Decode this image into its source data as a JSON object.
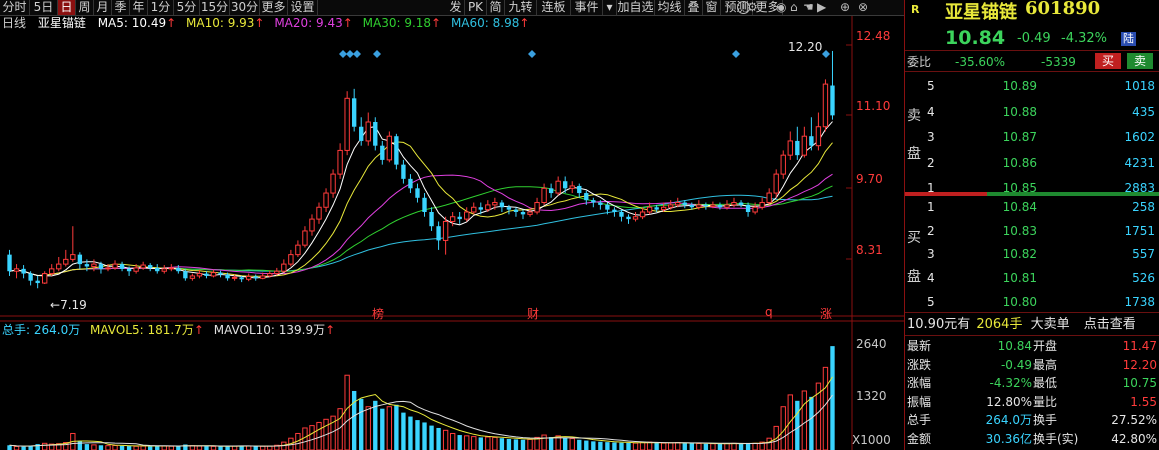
{
  "toolbar": {
    "left": [
      "分时",
      "5日",
      "日",
      "周",
      "月",
      "季",
      "年",
      "1分",
      "5分",
      "15分",
      "30分",
      "更多",
      "设置"
    ],
    "active_index": 2,
    "right": [
      "发",
      "PK",
      "简",
      "九转",
      "连板",
      "事件",
      "",
      "加自选",
      "均线",
      "叠",
      "窗",
      "预测",
      "更多"
    ]
  },
  "ma_legend": {
    "period": "日线",
    "name": "亚星锚链",
    "ma5": "MA5: 10.49",
    "ma10": "MA10: 9.93",
    "ma20": "MA20: 9.43",
    "ma30": "MA30: 9.18",
    "ma60": "MA60: 8.98"
  },
  "colors": {
    "ma5": "#ffffff",
    "ma10": "#e8e83a",
    "ma20": "#e040e0",
    "ma30": "#30d030",
    "ma60": "#30c0e0",
    "up": "#ff3b3b",
    "down": "#3ad4ff"
  },
  "price_axis": [
    "12.48",
    "11.10",
    "9.70",
    "8.31"
  ],
  "high_label": "12.20",
  "low_label": "7.19",
  "event_markers": [
    "榜",
    "财",
    "q",
    "涨"
  ],
  "volume_legend": {
    "total": "总手: 264.0万",
    "mavol5": "MAVOL5: 181.7万",
    "mavol10": "MAVOL10: 139.9万"
  },
  "volume_axis": [
    "2640",
    "1320",
    "X1000"
  ],
  "quote": {
    "badge": "R",
    "name": "亚星锚链",
    "code": "601890",
    "price": "10.84",
    "change": "-0.49",
    "change_pct": "-4.32%",
    "tag": "陆"
  },
  "weibi": {
    "label": "委比",
    "pct": "-35.60%",
    "diff": "-5339",
    "buy": "买",
    "sell": "卖"
  },
  "sell_side_label": [
    "卖",
    "盘"
  ],
  "buy_side_label": [
    "买",
    "盘"
  ],
  "sell_orders": [
    {
      "level": "5",
      "price": "10.89",
      "vol": "1018"
    },
    {
      "level": "4",
      "price": "10.88",
      "vol": "435"
    },
    {
      "level": "3",
      "price": "10.87",
      "vol": "1602"
    },
    {
      "level": "2",
      "price": "10.86",
      "vol": "4231"
    },
    {
      "level": "1",
      "price": "10.85",
      "vol": "2883"
    }
  ],
  "buy_orders": [
    {
      "level": "1",
      "price": "10.84",
      "vol": "258"
    },
    {
      "level": "2",
      "price": "10.83",
      "vol": "1751"
    },
    {
      "level": "3",
      "price": "10.82",
      "vol": "557"
    },
    {
      "level": "4",
      "price": "10.81",
      "vol": "526"
    },
    {
      "level": "5",
      "price": "10.80",
      "vol": "1738"
    }
  ],
  "big_order": {
    "price": "10.90元有",
    "vol": "2064手",
    "label": "大卖单",
    "link": "点击查看"
  },
  "stats": [
    {
      "l1": "最新",
      "v1": "10.84",
      "c1": "green",
      "l2": "开盘",
      "v2": "11.47",
      "c2": "red"
    },
    {
      "l1": "涨跌",
      "v1": "-0.49",
      "c1": "green",
      "l2": "最高",
      "v2": "12.20",
      "c2": "red"
    },
    {
      "l1": "涨幅",
      "v1": "-4.32%",
      "c1": "green",
      "l2": "最低",
      "v2": "10.75",
      "c2": "green"
    },
    {
      "l1": "振幅",
      "v1": "12.80%",
      "c1": "white",
      "l2": "量比",
      "v2": "1.55",
      "c2": "red"
    },
    {
      "l1": "总手",
      "v1": "264.0万",
      "c1": "cyan",
      "l2": "换手",
      "v2": "27.52%",
      "c2": "white"
    },
    {
      "l1": "金额",
      "v1": "30.36亿",
      "c1": "cyan",
      "l2": "换手(实)",
      "v2": "42.80%",
      "c2": "white"
    }
  ],
  "chart_data": {
    "type": "candlestick",
    "price_range": [
      6.9,
      12.6
    ],
    "volume_max": 2640,
    "candles": [
      [
        7.9,
        7.55,
        8.0,
        7.45,
        120
      ],
      [
        7.55,
        7.6,
        7.7,
        7.4,
        90
      ],
      [
        7.6,
        7.5,
        7.68,
        7.4,
        85
      ],
      [
        7.5,
        7.35,
        7.55,
        7.25,
        110
      ],
      [
        7.35,
        7.3,
        7.45,
        7.19,
        150
      ],
      [
        7.3,
        7.5,
        7.55,
        7.28,
        170
      ],
      [
        7.5,
        7.6,
        7.7,
        7.45,
        150
      ],
      [
        7.6,
        7.7,
        7.85,
        7.55,
        160
      ],
      [
        7.7,
        7.8,
        8.0,
        7.65,
        190
      ],
      [
        7.8,
        7.9,
        8.5,
        7.75,
        420
      ],
      [
        7.9,
        7.7,
        7.95,
        7.6,
        220
      ],
      [
        7.7,
        7.65,
        7.8,
        7.55,
        150
      ],
      [
        7.65,
        7.7,
        7.8,
        7.55,
        130
      ],
      [
        7.7,
        7.6,
        7.75,
        7.5,
        120
      ],
      [
        7.6,
        7.62,
        7.7,
        7.55,
        110
      ],
      [
        7.62,
        7.7,
        7.78,
        7.58,
        115
      ],
      [
        7.7,
        7.6,
        7.75,
        7.55,
        105
      ],
      [
        7.6,
        7.55,
        7.65,
        7.45,
        100
      ],
      [
        7.55,
        7.62,
        7.7,
        7.5,
        95
      ],
      [
        7.62,
        7.68,
        7.75,
        7.58,
        100
      ],
      [
        7.68,
        7.62,
        7.72,
        7.55,
        110
      ],
      [
        7.62,
        7.55,
        7.7,
        7.5,
        105
      ],
      [
        7.55,
        7.6,
        7.68,
        7.5,
        100
      ],
      [
        7.6,
        7.62,
        7.7,
        7.55,
        95
      ],
      [
        7.62,
        7.55,
        7.68,
        7.5,
        90
      ],
      [
        7.55,
        7.4,
        7.6,
        7.35,
        140
      ],
      [
        7.4,
        7.45,
        7.5,
        7.35,
        110
      ],
      [
        7.45,
        7.5,
        7.58,
        7.4,
        100
      ],
      [
        7.5,
        7.45,
        7.55,
        7.4,
        95
      ],
      [
        7.45,
        7.52,
        7.58,
        7.42,
        92
      ],
      [
        7.52,
        7.48,
        7.56,
        7.42,
        90
      ],
      [
        7.48,
        7.4,
        7.52,
        7.35,
        110
      ],
      [
        7.4,
        7.42,
        7.48,
        7.35,
        100
      ],
      [
        7.42,
        7.38,
        7.45,
        7.32,
        105
      ],
      [
        7.38,
        7.44,
        7.5,
        7.34,
        100
      ],
      [
        7.44,
        7.4,
        7.48,
        7.35,
        95
      ],
      [
        7.4,
        7.45,
        7.52,
        7.38,
        95
      ],
      [
        7.45,
        7.5,
        7.56,
        7.42,
        100
      ],
      [
        7.5,
        7.55,
        7.62,
        7.46,
        120
      ],
      [
        7.55,
        7.7,
        7.8,
        7.52,
        200
      ],
      [
        7.7,
        7.9,
        8.0,
        7.65,
        300
      ],
      [
        7.9,
        8.1,
        8.2,
        7.85,
        420
      ],
      [
        8.1,
        8.4,
        8.5,
        8.05,
        560
      ],
      [
        8.4,
        8.65,
        8.75,
        8.3,
        620
      ],
      [
        8.65,
        8.9,
        9.0,
        8.55,
        700
      ],
      [
        8.9,
        9.2,
        9.3,
        8.8,
        780
      ],
      [
        9.2,
        9.6,
        9.7,
        9.1,
        860
      ],
      [
        9.6,
        10.1,
        10.25,
        9.5,
        1050
      ],
      [
        10.1,
        11.2,
        11.35,
        10.0,
        1900
      ],
      [
        11.2,
        10.6,
        11.4,
        10.5,
        1500
      ],
      [
        10.6,
        10.3,
        10.8,
        10.2,
        1300
      ],
      [
        10.3,
        10.7,
        10.9,
        10.2,
        1100
      ],
      [
        10.7,
        10.2,
        10.8,
        10.1,
        1250
      ],
      [
        10.2,
        9.9,
        10.3,
        9.8,
        1050
      ],
      [
        9.9,
        10.4,
        10.5,
        9.85,
        1100
      ],
      [
        10.4,
        9.8,
        10.45,
        9.7,
        1150
      ],
      [
        9.8,
        9.5,
        9.9,
        9.4,
        950
      ],
      [
        9.5,
        9.3,
        9.6,
        9.2,
        850
      ],
      [
        9.3,
        9.1,
        9.4,
        9.0,
        760
      ],
      [
        9.1,
        8.8,
        9.2,
        8.7,
        700
      ],
      [
        8.8,
        8.5,
        8.9,
        8.4,
        620
      ],
      [
        8.5,
        8.2,
        8.6,
        8.0,
        560
      ],
      [
        8.2,
        8.6,
        8.7,
        7.9,
        500
      ],
      [
        8.6,
        8.7,
        8.8,
        8.5,
        420
      ],
      [
        8.7,
        8.65,
        8.8,
        8.55,
        380
      ],
      [
        8.65,
        8.8,
        8.9,
        8.6,
        360
      ],
      [
        8.8,
        8.9,
        9.0,
        8.75,
        340
      ],
      [
        8.9,
        8.85,
        9.0,
        8.75,
        320
      ],
      [
        8.85,
        8.95,
        9.05,
        8.8,
        330
      ],
      [
        8.95,
        9.0,
        9.1,
        8.85,
        320
      ],
      [
        9.0,
        8.9,
        9.05,
        8.8,
        300
      ],
      [
        8.9,
        8.85,
        8.95,
        8.75,
        280
      ],
      [
        8.85,
        8.8,
        8.9,
        8.7,
        270
      ],
      [
        8.8,
        8.75,
        8.85,
        8.65,
        260
      ],
      [
        8.75,
        8.8,
        8.88,
        8.7,
        270
      ],
      [
        8.8,
        9.0,
        9.1,
        8.75,
        320
      ],
      [
        9.0,
        9.3,
        9.4,
        8.95,
        380
      ],
      [
        9.3,
        9.2,
        9.4,
        9.1,
        330
      ],
      [
        9.2,
        9.45,
        9.55,
        9.15,
        360
      ],
      [
        9.45,
        9.3,
        9.55,
        9.2,
        310
      ],
      [
        9.3,
        9.35,
        9.45,
        9.2,
        290
      ],
      [
        9.35,
        9.2,
        9.4,
        9.1,
        260
      ],
      [
        9.2,
        9.05,
        9.25,
        8.95,
        240
      ],
      [
        9.05,
        9.0,
        9.1,
        8.9,
        220
      ],
      [
        9.0,
        8.95,
        9.05,
        8.85,
        210
      ],
      [
        8.95,
        8.85,
        9.0,
        8.75,
        200
      ],
      [
        8.85,
        8.8,
        8.9,
        8.7,
        190
      ],
      [
        8.8,
        8.7,
        8.85,
        8.6,
        185
      ],
      [
        8.7,
        8.65,
        8.75,
        8.55,
        180
      ],
      [
        8.65,
        8.7,
        8.8,
        8.6,
        175
      ],
      [
        8.7,
        8.8,
        8.9,
        8.65,
        190
      ],
      [
        8.8,
        8.9,
        9.0,
        8.75,
        200
      ],
      [
        8.9,
        8.85,
        8.95,
        8.8,
        180
      ],
      [
        8.85,
        8.9,
        9.0,
        8.8,
        175
      ],
      [
        8.9,
        8.95,
        9.05,
        8.85,
        180
      ],
      [
        8.95,
        9.0,
        9.1,
        8.9,
        190
      ],
      [
        9.0,
        8.95,
        9.05,
        8.88,
        175
      ],
      [
        8.95,
        8.9,
        9.0,
        8.85,
        170
      ],
      [
        8.9,
        8.95,
        9.05,
        8.85,
        165
      ],
      [
        8.95,
        8.92,
        9.0,
        8.85,
        160
      ],
      [
        8.92,
        8.95,
        9.02,
        8.88,
        160
      ],
      [
        8.95,
        8.9,
        9.0,
        8.85,
        155
      ],
      [
        8.9,
        8.95,
        9.05,
        8.85,
        165
      ],
      [
        8.95,
        9.0,
        9.1,
        8.9,
        170
      ],
      [
        9.0,
        8.95,
        9.05,
        8.9,
        160
      ],
      [
        8.95,
        8.8,
        9.0,
        8.7,
        180
      ],
      [
        8.8,
        8.9,
        9.0,
        8.75,
        170
      ],
      [
        8.9,
        9.0,
        9.1,
        8.85,
        200
      ],
      [
        9.0,
        9.2,
        9.3,
        8.95,
        300
      ],
      [
        9.2,
        9.6,
        9.7,
        9.1,
        600
      ],
      [
        9.6,
        10.0,
        10.1,
        9.5,
        1100
      ],
      [
        10.0,
        10.3,
        10.5,
        9.9,
        1400
      ],
      [
        10.3,
        10.0,
        10.6,
        9.9,
        1250
      ],
      [
        10.0,
        10.4,
        10.6,
        9.95,
        1500
      ],
      [
        10.4,
        10.2,
        10.8,
        10.1,
        1350
      ],
      [
        10.2,
        10.6,
        10.9,
        10.1,
        1700
      ],
      [
        10.6,
        11.5,
        11.6,
        10.5,
        2100
      ],
      [
        11.47,
        10.84,
        12.2,
        10.75,
        2640
      ]
    ]
  }
}
